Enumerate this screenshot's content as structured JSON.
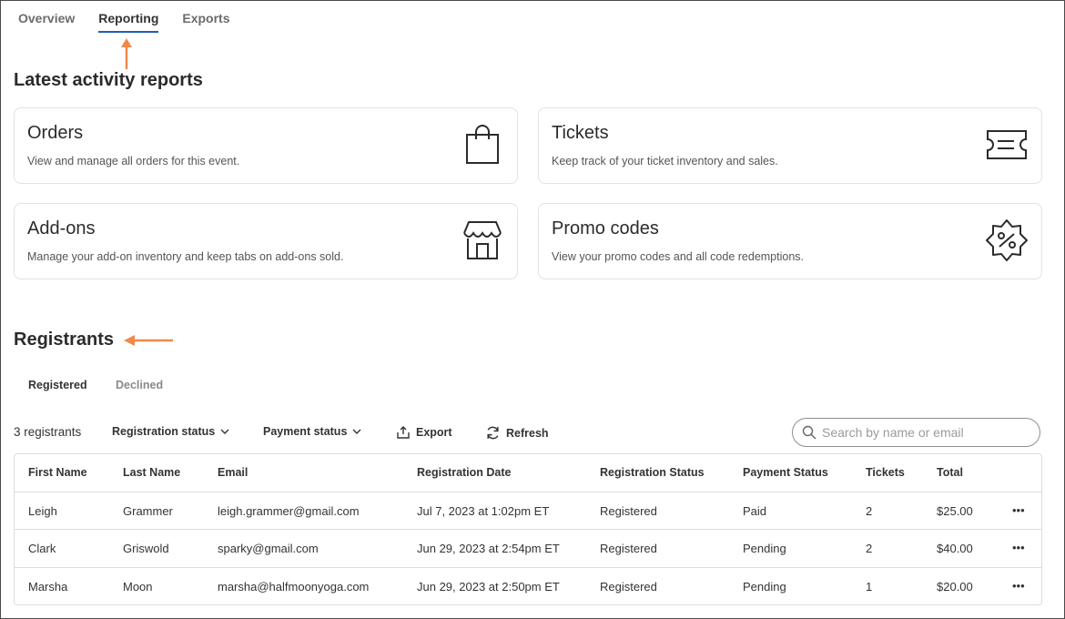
{
  "tabs": [
    "Overview",
    "Reporting",
    "Exports"
  ],
  "activity": {
    "heading": "Latest activity reports",
    "cards": [
      {
        "title": "Orders",
        "desc": "View and manage all orders for this event.",
        "icon": "shopping-bag-icon"
      },
      {
        "title": "Tickets",
        "desc": "Keep track of your ticket inventory and sales.",
        "icon": "ticket-icon"
      },
      {
        "title": "Add-ons",
        "desc": "Manage your add-on inventory and keep tabs on add-ons sold.",
        "icon": "storefront-icon"
      },
      {
        "title": "Promo codes",
        "desc": "View your promo codes and all code redemptions.",
        "icon": "percent-badge-icon"
      }
    ]
  },
  "registrants": {
    "heading": "Registrants",
    "subtabs": [
      "Registered",
      "Declined"
    ],
    "count": "3 registrants",
    "filters": {
      "registration_status": "Registration status",
      "payment_status": "Payment status"
    },
    "actions": {
      "export": "Export",
      "refresh": "Refresh"
    },
    "search_placeholder": "Search by name or email",
    "columns": [
      "First Name",
      "Last Name",
      "Email",
      "Registration Date",
      "Registration Status",
      "Payment Status",
      "Tickets",
      "Total"
    ],
    "rows": [
      {
        "first": "Leigh",
        "last": "Grammer",
        "email": "leigh.grammer@gmail.com",
        "date": "Jul 7, 2023 at 1:02pm ET",
        "reg_status": "Registered",
        "pay_status": "Paid",
        "tickets": "2",
        "total": "$25.00"
      },
      {
        "first": "Clark",
        "last": "Griswold",
        "email": "sparky@gmail.com",
        "date": "Jun 29, 2023 at 2:54pm ET",
        "reg_status": "Registered",
        "pay_status": "Pending",
        "tickets": "2",
        "total": "$40.00"
      },
      {
        "first": "Marsha",
        "last": "Moon",
        "email": "marsha@halfmoonyoga.com",
        "date": "Jun 29, 2023 at 2:50pm ET",
        "reg_status": "Registered",
        "pay_status": "Pending",
        "tickets": "1",
        "total": "$20.00"
      }
    ],
    "row_menu_glyph": "•••"
  },
  "colors": {
    "accent": "#1f5eb8",
    "annotation_arrow": "#f0884a"
  }
}
